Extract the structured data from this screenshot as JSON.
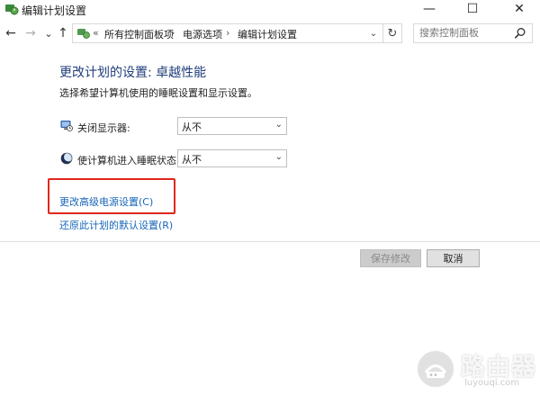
{
  "window": {
    "title": "编辑计划设置",
    "controls": {
      "minimize": "—",
      "maximize": "☐",
      "close": "✕"
    }
  },
  "nav": {
    "back": "←",
    "forward": "→",
    "history": "⌄",
    "up": "↑",
    "refresh": "↻",
    "breadcrumb": {
      "overflow": "«",
      "items": [
        "所有控制面板项",
        "电源选项",
        "编辑计划设置"
      ],
      "separator": "›",
      "dropdown": "⌄"
    },
    "search": {
      "placeholder": "搜索控制面板"
    }
  },
  "main": {
    "heading": "更改计划的设置: 卓越性能",
    "subtext": "选择希望计算机使用的睡眠设置和显示设置。",
    "rows": [
      {
        "label": "关闭显示器:",
        "value": "从不",
        "icon": "monitor-clock-icon"
      },
      {
        "label": "使计算机进入睡眠状态:",
        "value": "从不",
        "icon": "moon-icon"
      }
    ],
    "links": {
      "advanced": "更改高级电源设置(C)",
      "restore": "还原此计划的默认设置(R)"
    },
    "buttons": {
      "save": "保存修改",
      "cancel": "取消"
    }
  },
  "watermark": {
    "title": "路由器",
    "subtitle": "luyouqi.com"
  },
  "colors": {
    "heading": "#1f3d7a",
    "link": "#1666b8",
    "highlight_border": "#e0271b"
  }
}
